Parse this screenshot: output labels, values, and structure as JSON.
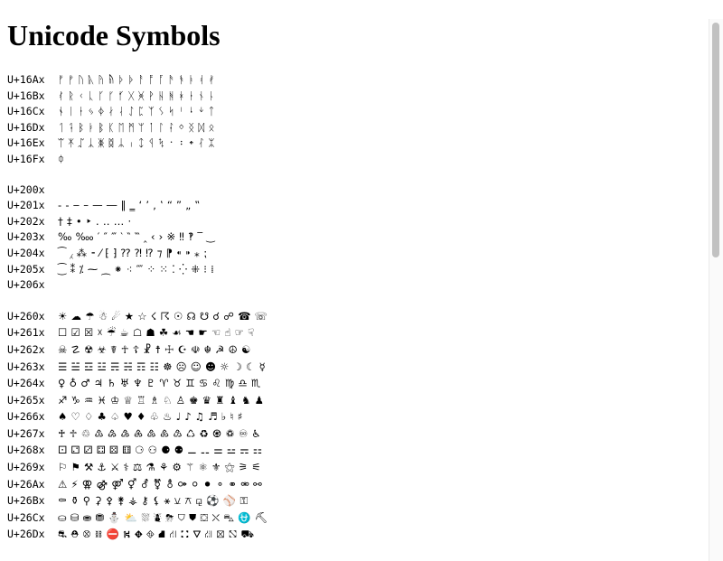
{
  "page": {
    "title": "Unicode Symbols"
  },
  "blocks": [
    {
      "rows": [
        {
          "code": "U+16Ax",
          "chars": "ᚠᚡᚢᚣᚤᚥᚦᚧᚨᚩᚪᚫᚬᚭᚮᚯ"
        },
        {
          "code": "U+16Bx",
          "chars": "ᚰᚱᚲᚳᚴᚵᚶᚷᚸᚹᚺᚻᚼᚽᚾᚿ"
        },
        {
          "code": "U+16Cx",
          "chars": "ᛀᛁᛂᛃᛄᛅᛆᛇᛈᛉᛊᛋᛌᛍᛎᛏ"
        },
        {
          "code": "U+16Dx",
          "chars": "ᛐᛑᛒᛓᛔᛕᛖᛗᛘᛙᛚᛛᛜᛝᛞᛟ"
        },
        {
          "code": "U+16Ex",
          "chars": "ᛠᛡᛢᛣᛤᛥᛦᛧᛨᛩᛪ᛫᛬᛭ᛮᛯ"
        },
        {
          "code": "U+16Fx",
          "chars": "ᛰ"
        }
      ]
    },
    {
      "rows": [
        {
          "code": "U+200x",
          "chars": ""
        },
        {
          "code": "U+201x",
          "chars": "‐‑‒–—―‖‗‘’‚‛“”„‟"
        },
        {
          "code": "U+202x",
          "chars": "†‡•‣․‥…‧"
        },
        {
          "code": "U+203x",
          "chars": "‰‱′″‴‵‶‷‸‹›※‼‽‾‿"
        },
        {
          "code": "U+204x",
          "chars": "⁀⁁⁂⁃⁄⁅⁆⁇⁈⁉⁊⁋⁌⁍⁎⁏"
        },
        {
          "code": "U+205x",
          "chars": "⁐⁑⁒⁓⁔⁕⁖⁗⁘⁙⁚⁛⁜⁝⁞"
        },
        {
          "code": "U+206x",
          "chars": ""
        }
      ]
    },
    {
      "rows": [
        {
          "code": "U+260x",
          "chars": "☀☁☂☃☄★☆☇☈☉☊☋☌☍☎☏"
        },
        {
          "code": "U+261x",
          "chars": "☐☑☒☓☔☕☖☗☘☙☚☛☜☝☞☟"
        },
        {
          "code": "U+262x",
          "chars": "☠☡☢☣☤☥☦☧☨☩☪☫☬☭☮☯"
        },
        {
          "code": "U+263x",
          "chars": "☰☱☲☳☴☵☶☷☸☹☺☻☼☽☾☿"
        },
        {
          "code": "U+264x",
          "chars": "♀♁♂♃♄♅♆♇♈♉♊♋♌♍♎♏"
        },
        {
          "code": "U+265x",
          "chars": "♐♑♒♓♔♕♖♗♘♙♚♛♜♝♞♟"
        },
        {
          "code": "U+266x",
          "chars": "♠♡♢♣♤♥♦♧♨♩♪♫♬♭♮♯"
        },
        {
          "code": "U+267x",
          "chars": "♰♱♲♳♴♵♶♷♸♹♺♻♼♽♾♿"
        },
        {
          "code": "U+268x",
          "chars": "⚀⚁⚂⚃⚄⚅⚆⚇⚈⚉⚊⚋⚌⚍⚎⚏"
        },
        {
          "code": "U+269x",
          "chars": "⚐⚑⚒⚓⚔⚕⚖⚗⚘⚙⚚⚛⚜⚝⚞⚟"
        },
        {
          "code": "U+26Ax",
          "chars": "⚠⚡⚢⚣⚤⚥⚦⚧⚨⚩⚪⚫⚬⚭⚮⚯"
        },
        {
          "code": "U+26Bx",
          "chars": "⚰⚱⚲⚳⚴⚵⚶⚷⚸⚹⚺⚻⚼⚽⚾⚿"
        },
        {
          "code": "U+26Cx",
          "chars": "⛀⛁⛂⛃⛄⛅⛆⛇⛈⛉⛊⛋⛌⛍⛎⛏"
        },
        {
          "code": "U+26Dx",
          "chars": "⛐⛑⛒⛓⛔⛕⛖⛗⛘⛙⛚⛛⛜⛝⛞⛟"
        }
      ]
    }
  ]
}
